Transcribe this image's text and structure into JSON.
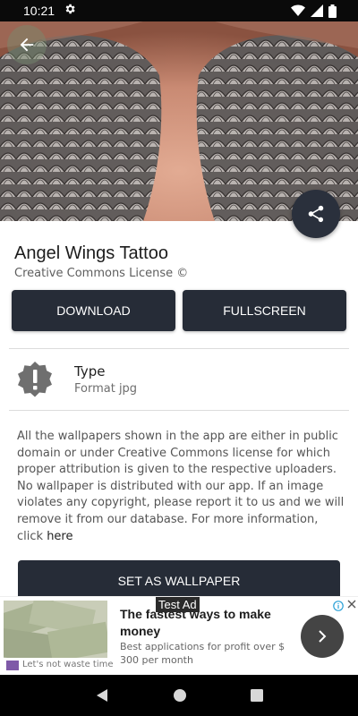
{
  "status_bar": {
    "time": "10:21"
  },
  "header": {
    "title": "Angel Wings Tattoo",
    "license": "Creative Commons License ©"
  },
  "actions": {
    "download_label": "DOWNLOAD",
    "fullscreen_label": "FULLSCREEN",
    "set_wallpaper_label": "SET AS WALLPAPER"
  },
  "info": {
    "type_label": "Type",
    "type_value": "Format jpg"
  },
  "description": {
    "text": "All the wallpapers shown in the app are either in public domain or under Creative Commons license for which proper attribution is given to the respective uploaders. No wallpaper is distributed with our app. If an image violates any copyright, please report it to us and we will remove it from our database. For more information, click ",
    "link_label": "here"
  },
  "ad": {
    "tag": "Test Ad",
    "title": "The fastest ways to make money",
    "subtitle": "Best applications for profit over $ 300 per month",
    "caption": "Let's not waste time"
  },
  "colors": {
    "button_bg": "#262c37",
    "fab_bg": "#2a303c"
  }
}
